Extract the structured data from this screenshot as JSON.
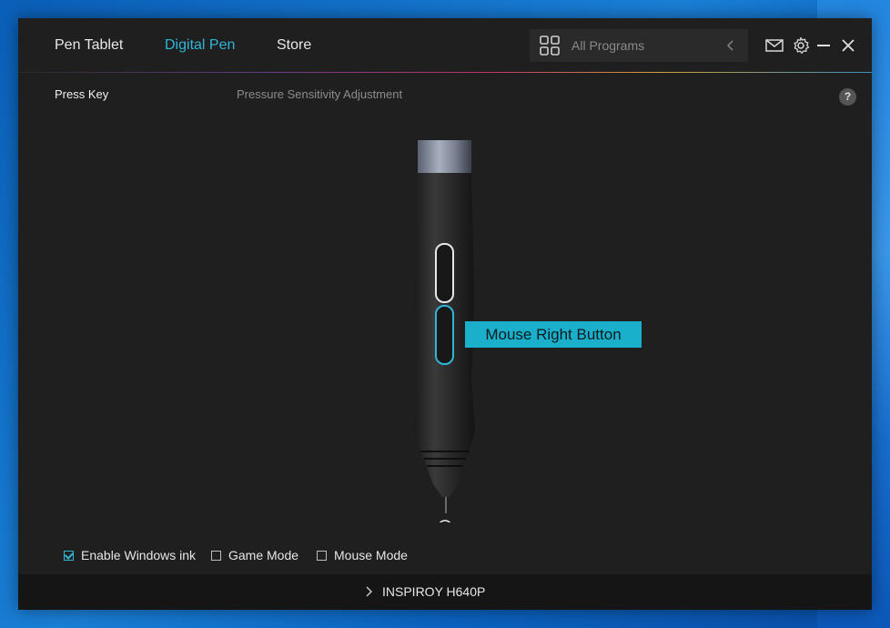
{
  "app": {
    "tabs": [
      {
        "label": "Pen Tablet",
        "active": false
      },
      {
        "label": "Digital Pen",
        "active": true
      },
      {
        "label": "Store",
        "active": false
      }
    ],
    "program_selector": {
      "label": "All Programs"
    },
    "icons": [
      "grid-icon",
      "chevron-left-icon",
      "mail-icon",
      "gear-icon",
      "minimize-icon",
      "close-icon"
    ]
  },
  "subnav": {
    "press_key": "Press Key",
    "pressure": "Pressure Sensitivity Adjustment",
    "help": "?"
  },
  "pen": {
    "highlighted_button": "lower",
    "callout_label": "Mouse Right Button"
  },
  "options": [
    {
      "label": "Enable Windows ink",
      "checked": true
    },
    {
      "label": "Game Mode",
      "checked": false
    },
    {
      "label": "Mouse Mode",
      "checked": false
    }
  ],
  "device": {
    "name": "INSPIROY H640P"
  },
  "colors": {
    "accent": "#2fb6d6",
    "callout": "#1ab0cc",
    "window_bg": "#1f1f1f"
  }
}
